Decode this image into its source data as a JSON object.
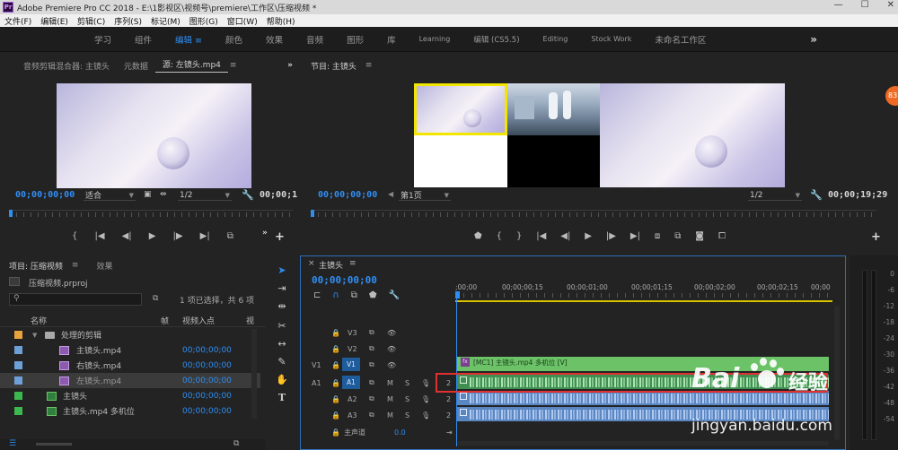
{
  "titlebar": {
    "logo": "Pr",
    "title": "Adobe Premiere Pro CC 2018 - E:\\1影视区\\视频号\\premiere\\工作区\\压缩视频 *",
    "minimize": "—",
    "maximize": "☐",
    "close": "✕"
  },
  "menubar": {
    "items": [
      "文件(F)",
      "编辑(E)",
      "剪辑(C)",
      "序列(S)",
      "标记(M)",
      "图形(G)",
      "窗口(W)",
      "帮助(H)"
    ]
  },
  "workspaces": {
    "items": [
      "学习",
      "组件",
      "编辑",
      "颜色",
      "效果",
      "音频",
      "图形",
      "库",
      "Learning",
      "编辑 (CS5.5)",
      "Editing",
      "Stock Work",
      "未命名工作区"
    ],
    "active": "编辑",
    "more": "»"
  },
  "source_panel": {
    "tabs": [
      "音频剪辑混合器: 主镜头",
      "元数据",
      "源: 左镜头.mp4"
    ],
    "tab_menu": "≡",
    "overflow": "»",
    "timecode": "00;00;00;00",
    "fit": "适合",
    "resolution": "1/2",
    "duration": "00;00;1"
  },
  "program_panel": {
    "title": "节目: 主镜头",
    "menu": "≡",
    "timecode": "00;00;00;00",
    "page": "第1页",
    "resolution": "1/2",
    "duration": "00;00;19;29"
  },
  "project_panel": {
    "title": "项目: 压缩视频",
    "menu": "≡",
    "tab2": "效果",
    "filename": "压缩视频.prproj",
    "selection_info": "1 项已选择，共 6 项",
    "col_name": "名称",
    "col_rate": "帧",
    "col_inpoint": "视频入点",
    "col_more": "视",
    "rows": [
      {
        "name": "处理的剪辑",
        "tc": "",
        "color": "#e8a33d",
        "indent": 0
      },
      {
        "name": "主镜头.mp4",
        "tc": "00;00;00;00",
        "color": "#6ea0d8",
        "indent": 1
      },
      {
        "name": "右镜头.mp4",
        "tc": "00;00;00;00",
        "color": "#6ea0d8",
        "indent": 1
      },
      {
        "name": "左镜头.mp4",
        "tc": "00;00;00;00",
        "color": "#6ea0d8",
        "indent": 1
      },
      {
        "name": "主镜头",
        "tc": "00;00;00;00",
        "color": "#3cb84f",
        "indent": 0
      },
      {
        "name": "主镜头.mp4 多机位",
        "tc": "00;00;00;00",
        "color": "#3cb84f",
        "indent": 0
      }
    ]
  },
  "timeline": {
    "tab": "主镜头",
    "close": "×",
    "menu": "≡",
    "timecode": "00;00;00;00",
    "ruler": [
      ";00;00",
      "00;00;00;15",
      "00;00;01;00",
      "00;00;01;15",
      "00;00;02;00",
      "00;00;02;15",
      "00;00"
    ],
    "tracks": {
      "v3": "V3",
      "v2": "V2",
      "v1": "V1",
      "v1_src": "V1",
      "a1": "A1",
      "a1_src": "A1",
      "a2": "A2",
      "a3": "A3",
      "m": "M",
      "s": "S",
      "channels": "2",
      "master": "主声道",
      "master_val": "0.0"
    },
    "video_clip": "[MC1] 主镜头.mp4 多机位 [V]",
    "fx": "fx"
  },
  "meter": {
    "labels": [
      "0",
      "-6",
      "-12",
      "-18",
      "-24",
      "-30",
      "-36",
      "-42",
      "-48",
      "-54"
    ]
  },
  "side_badge": "83",
  "watermark": {
    "brand": "Bai",
    "brand2": "经验",
    "url": "jingyan.baidu.com"
  },
  "colors": {
    "accent": "#2e8df0",
    "video_clip": "#6bc267",
    "audio_clip_green": "#3f8e52",
    "audio_clip_blue": "#5a86c2",
    "highlight_box": "#e03030",
    "selected_thumb": "#f2e600"
  }
}
